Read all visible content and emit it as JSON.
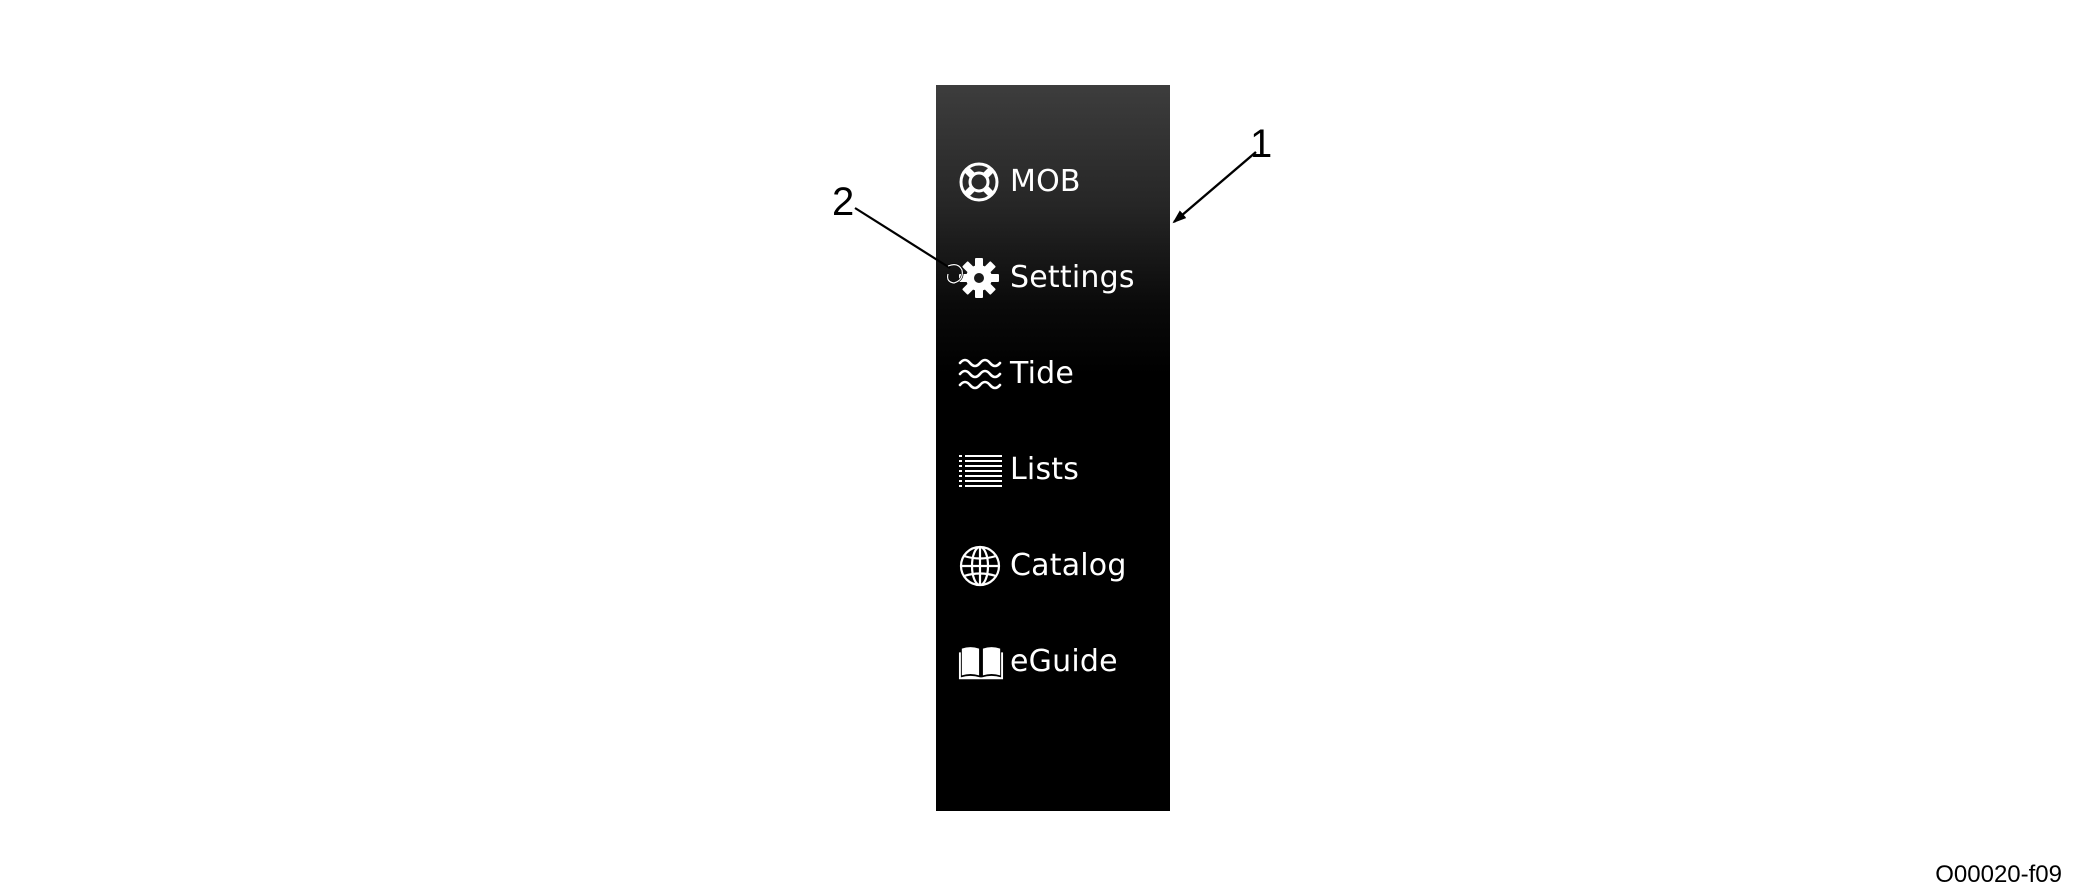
{
  "menu": {
    "items": [
      {
        "label": "MOB",
        "icon": "life-ring-icon"
      },
      {
        "label": "Settings",
        "icon": "gear-icon"
      },
      {
        "label": "Tide",
        "icon": "waves-icon"
      },
      {
        "label": "Lists",
        "icon": "list-icon"
      },
      {
        "label": "Catalog",
        "icon": "globe-icon"
      },
      {
        "label": "eGuide",
        "icon": "open-book-icon"
      }
    ],
    "background_color": "#000000",
    "text_color": "#ffffff"
  },
  "callouts": {
    "one": "1",
    "two": "2"
  },
  "figure_id": "O00020-f09"
}
